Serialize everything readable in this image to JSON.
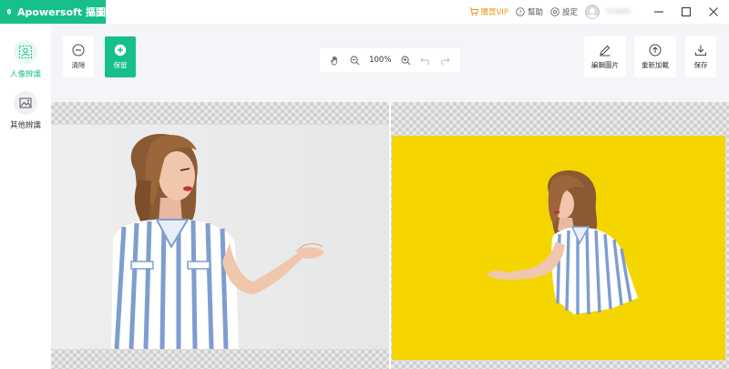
{
  "app": {
    "title": "Apowersoft 摳圖"
  },
  "titlebar": {
    "vip_label": "購買VIP",
    "help_label": "幫助",
    "settings_label": "設定",
    "username": "lirashi"
  },
  "sidebar": {
    "items": [
      {
        "label": "人像辨識",
        "active": true
      },
      {
        "label": "其他辨識",
        "active": false
      }
    ]
  },
  "toolbar": {
    "clear_label": "清除",
    "keep_label": "保留",
    "zoom": "100%",
    "edit_label": "編輯圖片",
    "reload_label": "重新加載",
    "save_label": "保存"
  },
  "colors": {
    "accent": "#17c08b",
    "vip": "#e59a1b",
    "result_background": "#f5d500"
  }
}
